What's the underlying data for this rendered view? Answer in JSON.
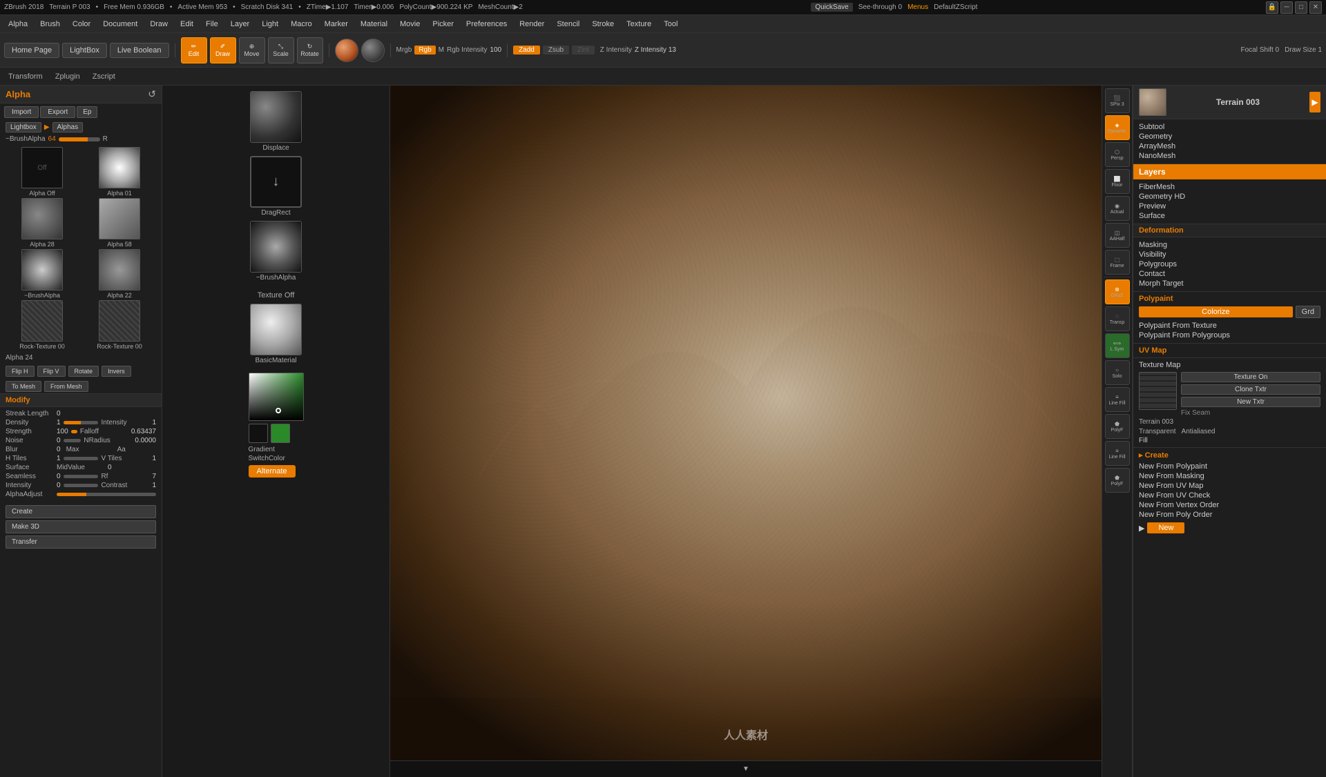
{
  "topbar": {
    "app": "ZBrush 2018",
    "project": "Terrain P 003",
    "divider1": "•",
    "free_mem": "Free Mem 0.936GB",
    "divider2": "•",
    "active_mem": "Active Mem 953",
    "divider3": "•",
    "scratch": "Scratch Disk 341",
    "divider4": "•",
    "ztime": "ZTime▶1.107",
    "timer": "Timer▶0.006",
    "polycount": "PolyCount▶900.224 KP",
    "meshcount": "MeshCount▶2",
    "quicksave": "QuickSave",
    "see_through": "See-through 0",
    "menus": "Menus",
    "default_script": "DefaultZScript"
  },
  "menubar": {
    "items": [
      "Alpha",
      "Brush",
      "Color",
      "Document",
      "Draw",
      "Edit",
      "File",
      "Layer",
      "Light",
      "Macro",
      "Marker",
      "Material",
      "Movie",
      "Picker",
      "Preferences",
      "Render",
      "Stencil",
      "Stroke",
      "Texture",
      "Tool"
    ]
  },
  "toolbar2": {
    "items": [
      "Transform",
      "Zplugin",
      "Zscript"
    ]
  },
  "toolbar": {
    "home_page": "Home Page",
    "light_box": "LightBox",
    "live_boolean": "Live Boolean",
    "edit_btn": "Edit",
    "draw_btn": "Draw",
    "move_btn": "Move",
    "scale_btn": "Scale",
    "rotate_btn": "Rotate",
    "mrgb_label": "Mrgb",
    "rgb_label": "Rgb",
    "rgb_val": "100",
    "m_label": "M",
    "zadd_label": "Zadd",
    "zsub_label": "Zsub",
    "zint_label": "Zint",
    "focal_shift": "Focal Shift 0",
    "draw_size": "Draw Size 1",
    "z_intensity": "Z Intensity 13"
  },
  "left_panel": {
    "alpha_title": "Alpha",
    "import_btn": "Import",
    "export_btn": "Export",
    "ep_btn": "Ep",
    "lightbox_btn": "Lightbox",
    "alphas_btn": "Alphas",
    "brush_alpha_label": "~BrushAlpha",
    "brush_alpha_val": "64",
    "alphas": [
      {
        "label": "Alpha Off",
        "type": "off"
      },
      {
        "label": "Alpha 01",
        "type": "light"
      },
      {
        "label": "Alpha 28",
        "type": "dark"
      },
      {
        "label": "Alpha 58",
        "type": "medium"
      },
      {
        "label": "~BrushAlpha",
        "type": "brush"
      },
      {
        "label": "Alpha 22",
        "type": "medium"
      },
      {
        "label": "Rock-Texture 00",
        "type": "rock"
      },
      {
        "label": "Rock-Texture 00",
        "type": "rock"
      },
      {
        "label": "Alpha 24",
        "type": "medium"
      }
    ],
    "flip_h": "Flip H",
    "flip_v": "Flip V",
    "rotate": "Rotate",
    "invers": "Invers",
    "to_mesh": "To Mesh",
    "from_mesh": "From Mesh",
    "modify_label": "Modify",
    "streak_length": "Streak Length 0",
    "density": "Density 1",
    "intensity": "Intensity 1",
    "strength": "Strength 100",
    "falloff": "Falloff 0.63437",
    "noise": "Noise 0",
    "nradius": "NRadius 0.0000:",
    "blur": "Blur 0",
    "max_label": "Max",
    "aa_label": "Aa",
    "h_tiles": "H Tiles 1",
    "v_tiles": "V Tiles 1",
    "surface_label": "Surface",
    "midvalue": "MidValue 0",
    "seamless": "Seamless 0",
    "rf_val": "Rf 7",
    "intensity_val": "Intensity 0",
    "contrast": "Contrast 1",
    "alpha_adjust": "AlphaAdjust",
    "create_btn": "Create",
    "make3d_btn": "Make 3D",
    "transfer_btn": "Transfer"
  },
  "center_panel": {
    "displace_label": "Displace",
    "dragrect_label": "DragRect",
    "brush_alpha_label": "~BrushAlpha",
    "texture_off_label": "Texture Off",
    "basic_material_label": "BasicMaterial",
    "gradient_label": "Gradient",
    "switch_color_label": "SwitchColor",
    "alternate_btn": "Alternate"
  },
  "right_sidebar": {
    "icons": [
      {
        "name": "spix",
        "label": "SPix 3"
      },
      {
        "name": "dynamic",
        "label": "Dynamic"
      },
      {
        "name": "persp",
        "label": "Persp"
      },
      {
        "name": "floor",
        "label": "Floor"
      },
      {
        "name": "actual",
        "label": "Actual"
      },
      {
        "name": "aahalf",
        "label": "AAHalf"
      },
      {
        "name": "frame",
        "label": "Frame"
      },
      {
        "name": "oxyz",
        "label": "OXyZ"
      },
      {
        "name": "transp",
        "label": "Transp"
      },
      {
        "name": "lsym",
        "label": "L Sym"
      },
      {
        "name": "solo",
        "label": "Solo"
      },
      {
        "name": "linefill1",
        "label": "Line Fill"
      },
      {
        "name": "polyf",
        "label": "PolyF"
      },
      {
        "name": "linefill2",
        "label": "Line Fill"
      },
      {
        "name": "polyf2",
        "label": "PolyF"
      }
    ]
  },
  "right_panel": {
    "terrain_name": "Terrain 003",
    "subtool_label": "Subtool",
    "geometry_label": "Geometry",
    "arraymesh_label": "ArrayMesh",
    "nanomesh_label": "NanoMesh",
    "layers_label": "Layers",
    "fibermesh_label": "FiberMesh",
    "geometry_hd_label": "Geometry HD",
    "preview_label": "Preview",
    "surface_label": "Surface",
    "deformation_label": "Deformation",
    "masking_label": "Masking",
    "visibility_label": "Visibility",
    "polygroups_label": "Polygroups",
    "contact_label": "Contact",
    "morph_target_label": "Morph Target",
    "polypaint_label": "Polypaint",
    "colorize_btn": "Colorize",
    "grd_btn": "Grd",
    "polypaint_from_texture": "Polypaint From Texture",
    "polypaint_from_polygroups": "Polypaint From Polygroups",
    "uv_map_label": "UV Map",
    "texture_map_label": "Texture Map",
    "texture_on_btn": "Texture On",
    "clone_txtr_btn": "Clone Txtr",
    "new_txtr_btn": "New Txtr",
    "fix_seam_btn": "Fix Seam",
    "terrain_003_label": "Terrain 003",
    "transparent_label": "Transparent",
    "antialiased_label": "Antialiased",
    "fill_label": "Fill",
    "create_label": "Create",
    "new_from_polypaint": "New From Polypaint",
    "new_from_masking": "New From Masking",
    "new_from_uv_map": "New From UV Map",
    "new_from_uv_check": "New From UV Check",
    "new_from_vertex_order": "New From Vertex Order",
    "new_from_poly_order": "New From Poly Order",
    "new_btn": "New"
  },
  "viewport": {
    "watermark": "人人素材"
  }
}
